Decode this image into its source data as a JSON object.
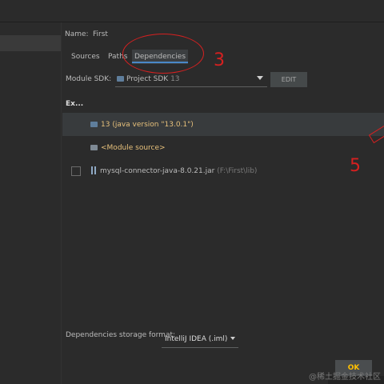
{
  "name": {
    "label": "Name:",
    "value": "First"
  },
  "tabs": [
    "Sources",
    "Paths",
    "Dependencies"
  ],
  "module_sdk": {
    "label": "Module SDK:",
    "value": "Project SDK",
    "version": "13",
    "edit_label": "EDIT"
  },
  "table": {
    "header": "Ex...",
    "rows": [
      {
        "label": "13 (java version \"13.0.1\")"
      },
      {
        "label": "<Module source>"
      },
      {
        "label": "mysql-connector-java-8.0.21.jar",
        "path": "(F:\\First\\lib)"
      }
    ]
  },
  "storage": {
    "label": "Dependencies storage format:",
    "value": "IntelliJ IDEA (.iml)"
  },
  "ok_label": "OK",
  "annotations": {
    "step_a": "3",
    "step_b": "5",
    "color": "#d62020"
  },
  "watermark": "@稀土掘金技术社区"
}
